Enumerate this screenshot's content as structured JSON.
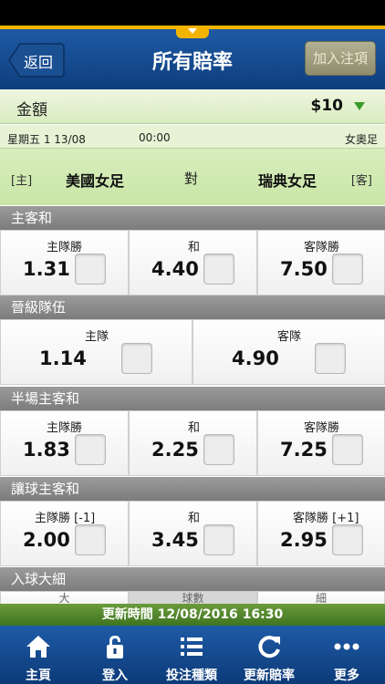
{
  "nav": {
    "back_label": "返回",
    "title": "所有賠率",
    "add_bet_label": "加入注項"
  },
  "amount": {
    "label": "金額",
    "value": "$10"
  },
  "match": {
    "date": "星期五 1 13/08",
    "time": "00:00",
    "league": "女奧足",
    "home_tag": "[主]",
    "home_team": "美國女足",
    "vs": "對",
    "away_team": "瑞典女足",
    "away_tag": "[客]"
  },
  "sections": [
    {
      "title": "主客和",
      "options": [
        {
          "label": "主隊勝",
          "odds": "1.31"
        },
        {
          "label": "和",
          "odds": "4.40"
        },
        {
          "label": "客隊勝",
          "odds": "7.50"
        }
      ]
    },
    {
      "title": "晉級隊伍",
      "options": [
        {
          "label": "主隊",
          "odds": "1.14"
        },
        {
          "label": "客隊",
          "odds": "4.90"
        }
      ]
    },
    {
      "title": "半場主客和",
      "options": [
        {
          "label": "主隊勝",
          "odds": "1.83"
        },
        {
          "label": "和",
          "odds": "2.25"
        },
        {
          "label": "客隊勝",
          "odds": "7.25"
        }
      ]
    },
    {
      "title": "讓球主客和",
      "options": [
        {
          "label": "主隊勝 [-1]",
          "odds": "2.00"
        },
        {
          "label": "和",
          "odds": "3.45"
        },
        {
          "label": "客隊勝 [+1]",
          "odds": "2.95"
        }
      ]
    },
    {
      "title": "入球大細",
      "options": [
        {
          "label": "大"
        },
        {
          "label": "球數"
        },
        {
          "label": "細"
        }
      ]
    }
  ],
  "update_bar": "更新時間 12/08/2016 16:30",
  "tabs": [
    {
      "label": "主頁",
      "icon": "home-icon"
    },
    {
      "label": "登入",
      "icon": "lock-icon"
    },
    {
      "label": "投注種類",
      "icon": "list-icon"
    },
    {
      "label": "更新賠率",
      "icon": "refresh-icon"
    },
    {
      "label": "更多",
      "icon": "more-icon"
    }
  ],
  "colors": {
    "nav_blue": "#1e5aa3",
    "nav_accent": "#f3b400",
    "amount_green": "#d9ecc0",
    "update_green": "#4f8a2c",
    "section_gray": "#8a8a8a"
  }
}
